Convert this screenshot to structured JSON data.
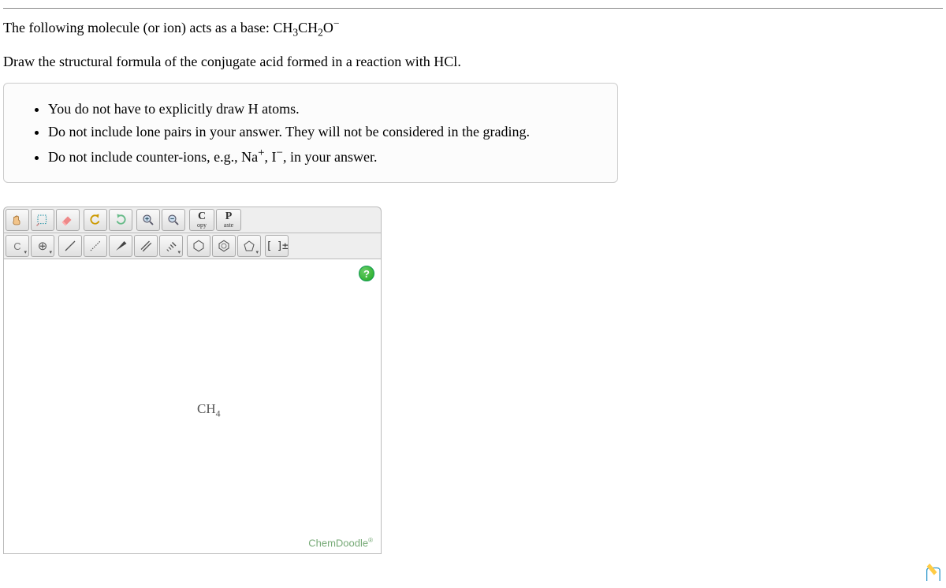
{
  "question": {
    "line1_pre": "The following molecule (or ion) acts as a base: ",
    "formula1_html": "CH<sub>3</sub>CH<sub>2</sub>O<sup>−</sup>",
    "line2_pre": "Draw the structural formula of the conjugate acid formed in a reaction with ",
    "formula2_html": "HCl",
    "line2_post": "."
  },
  "instructions": [
    "You do not have to explicitly draw H atoms.",
    "Do not include lone pairs in your answer. They will not be considered in the grading.",
    "Do not include counter-ions, e.g., Na<sup>+</sup>, I<sup>−</sup>, in your answer."
  ],
  "toolbar": {
    "copy_big": "C",
    "copy_small": "opy",
    "paste_big": "P",
    "paste_small": "aste",
    "atom_label": "C",
    "charge_label": "⊕",
    "bracket_label": "[ ]±"
  },
  "canvas": {
    "molecule": "CH<sub>4</sub>",
    "help": "?",
    "brand": "ChemDoodle",
    "brand_reg": "®"
  }
}
